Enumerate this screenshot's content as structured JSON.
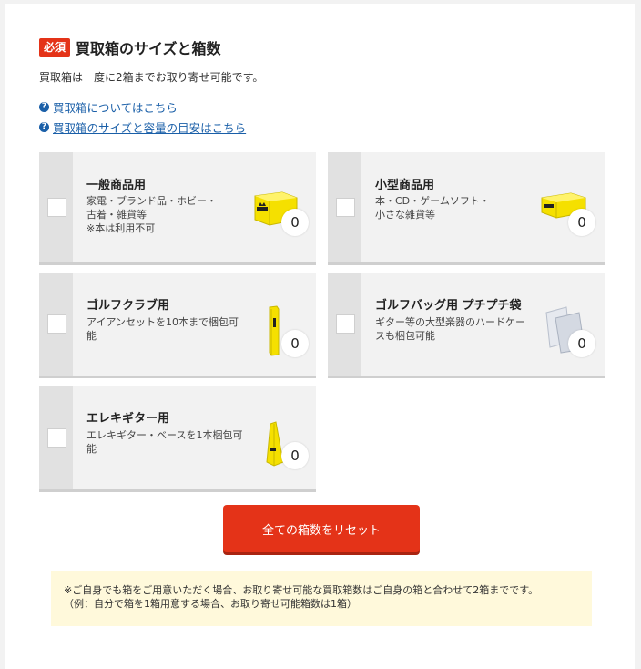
{
  "header": {
    "badge": "必須",
    "title": "買取箱のサイズと箱数",
    "subtitle": "買取箱は一度に2箱までお取り寄せ可能です。"
  },
  "links": [
    {
      "label": "買取箱についてはこちら"
    },
    {
      "label": "買取箱のサイズと容量の目安はこちら"
    }
  ],
  "cards": [
    {
      "title": "一般商品用",
      "desc": [
        "家電・ブランド品・ホビー・",
        "古着・雑貨等",
        "※本は利用不可"
      ],
      "count": "0",
      "box_label": "買取王子"
    },
    {
      "title": "小型商品用",
      "desc": [
        "本・CD・ゲームソフト・",
        "小さな雑貨等"
      ],
      "count": "0"
    },
    {
      "title": "ゴルフクラブ用",
      "desc": [
        "アイアンセットを10本まで梱包可",
        "能"
      ],
      "count": "0"
    },
    {
      "title": "ゴルフバッグ用 プチプチ袋",
      "desc": [
        "ギター等の大型楽器のハードケー",
        "スも梱包可能"
      ],
      "count": "0"
    },
    {
      "title": "エレキギター用",
      "desc": [
        "エレキギター・ベースを1本梱包可",
        "能"
      ],
      "count": "0"
    }
  ],
  "reset_button": "全ての箱数をリセット",
  "notice": [
    "※ご自身でも箱をご用意いただく場合、お取り寄せ可能な買取箱数はご自身の箱と合わせて2箱までです。",
    "（例：自分で箱を1箱用意する場合、お取り寄せ可能箱数は1箱）"
  ],
  "colors": {
    "accent": "#e43318",
    "link": "#1a5fa8",
    "box_yellow": "#f5e000",
    "notice_bg": "#fff9db"
  }
}
